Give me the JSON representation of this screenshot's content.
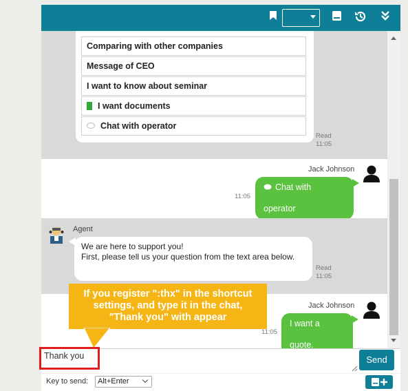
{
  "menu": {
    "items": [
      {
        "label": "Comparing with other companies"
      },
      {
        "label": "Message of CEO"
      },
      {
        "label": "I want to know about seminar"
      },
      {
        "label": "I want documents"
      },
      {
        "label": "Chat with operator"
      }
    ]
  },
  "messages": {
    "menu_read": "Read",
    "menu_time": "11:05",
    "user1_name": "Jack Johnson",
    "user1_text": "Chat with operator",
    "user1_time": "11:05",
    "agent_name": "Agent",
    "agent_line1": "We are here to support you!",
    "agent_line2": "First, please tell us your question from the text area below.",
    "agent_read": "Read",
    "agent_time": "11:05",
    "user2_name": "Jack Johnson",
    "user2_text": "I want a quote.",
    "user2_time": "11:05"
  },
  "composer": {
    "value": "Thank you",
    "send_label": "Send"
  },
  "footer": {
    "key_to_send_label": "Key to send:",
    "key_to_send_value": "Alt+Enter"
  },
  "annotation": {
    "line1": "If you register \":thx\" in the shortcut",
    "line2": "settings, and type it in the chat,",
    "line3": "\"Thank you\" with appear"
  },
  "icons": {
    "topbar": [
      "bookmark-icon",
      "book-icon",
      "history-icon",
      "collapse-icon"
    ],
    "menu": [
      "document-icon",
      "speech-bubble-icon"
    ],
    "footer": [
      "add-note-icon"
    ]
  },
  "colors": {
    "header": "#0e7f96",
    "user_bubble": "#5ac23f",
    "callout": "#f5b514",
    "highlight": "#e21d1d"
  }
}
